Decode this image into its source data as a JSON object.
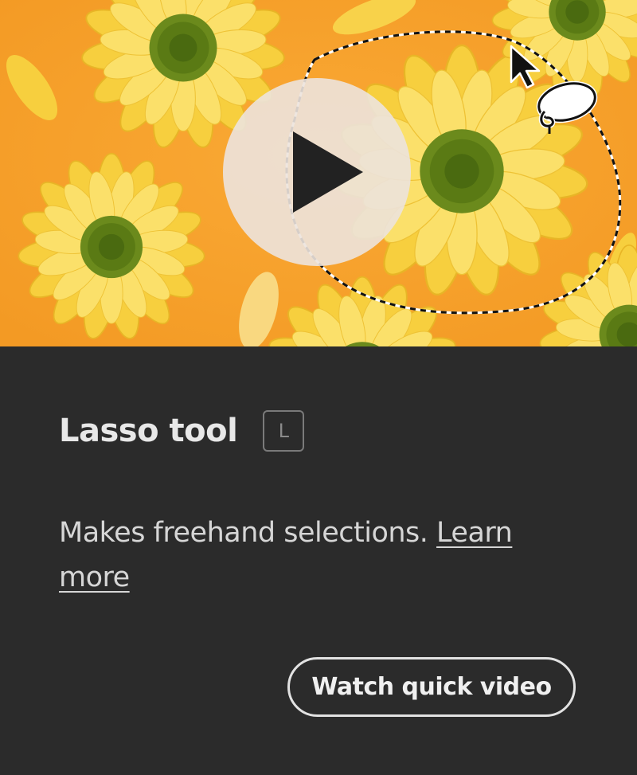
{
  "tooltip": {
    "title": "Lasso tool",
    "shortcut": "L",
    "description": "Makes freehand selections.",
    "learn_more": "Learn more",
    "watch_button": "Watch quick video"
  },
  "preview": {
    "background_color": "#f7a22c",
    "flower_color": "#f9d547",
    "flower_center_color": "#5b7a1a",
    "play_icon": "play-icon",
    "cursor_icon": "arrow-cursor-icon",
    "lasso_icon": "lasso-icon"
  }
}
